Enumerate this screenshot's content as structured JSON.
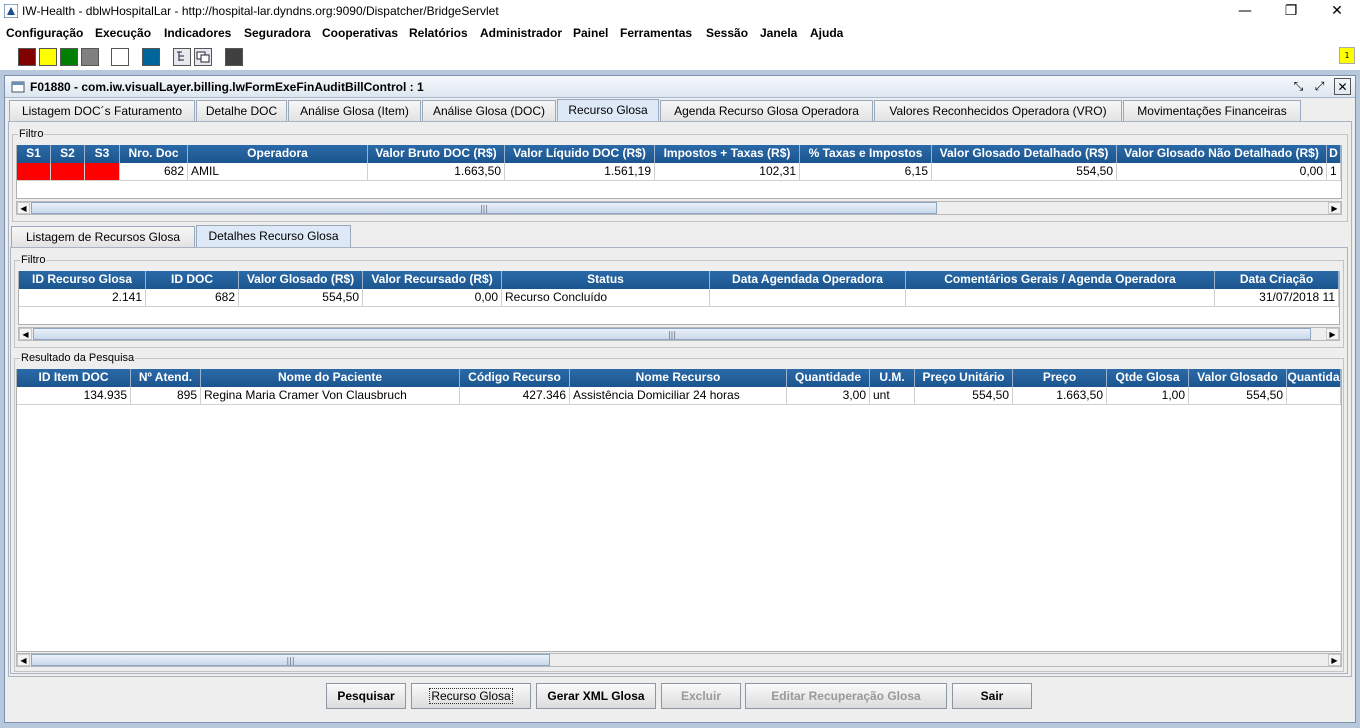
{
  "window": {
    "title": "IW-Health - dblwHospitalLar - http://hospital-lar.dyndns.org:9090/Dispatcher/BridgeServlet",
    "minimize": "—",
    "maximize": "❐",
    "close": "✕"
  },
  "menu": [
    "Configuração",
    "Execução",
    "Indicadores",
    "Seguradora",
    "Cooperativas",
    "Relatórios",
    "Administrador",
    "Painel",
    "Ferramentas",
    "Sessão",
    "Janela",
    "Ajuda"
  ],
  "toolbar": {
    "swatch_colors": [
      "#800000",
      "#ffff00",
      "#008000",
      "#808080",
      "#ffffff",
      "#006699",
      "#404040"
    ],
    "notification": "1"
  },
  "frame": {
    "title": "F01880 - com.iw.visualLayer.billing.lwFormExeFinAuditBillControl : 1"
  },
  "main_tabs": [
    "Listagem DOC´s Faturamento",
    "Detalhe DOC",
    "Análise Glosa (Item)",
    "Análise Glosa (DOC)",
    "Recurso Glosa",
    "Agenda Recurso Glosa Operadora",
    "Valores Reconhecidos Operadora (VRO)",
    "Movimentações Financeiras"
  ],
  "main_tab_active": "Recurso Glosa",
  "filtro1": {
    "label": "Filtro",
    "headers": [
      "S1",
      "S2",
      "S3",
      "Nro. Doc",
      "Operadora",
      "Valor Bruto DOC (R$)",
      "Valor Líquido DOC (R$)",
      "Impostos + Taxas (R$)",
      "% Taxas e Impostos",
      "Valor Glosado Detalhado (R$)",
      "Valor Glosado Não Detalhado (R$)",
      "D"
    ],
    "row": [
      "",
      "",
      "",
      "682",
      "AMIL",
      "1.663,50",
      "1.561,19",
      "102,31",
      "6,15",
      "554,50",
      "0,00",
      "1"
    ]
  },
  "sub_tabs": [
    "Listagem de Recursos Glosa",
    "Detalhes Recurso Glosa"
  ],
  "sub_tab_active": "Detalhes Recurso Glosa",
  "filtro2": {
    "label": "Filtro",
    "headers": [
      "ID Recurso Glosa",
      "ID DOC",
      "Valor Glosado (R$)",
      "Valor Recursado (R$)",
      "Status",
      "Data Agendada Operadora",
      "Comentários Gerais / Agenda Operadora",
      "Data Criação"
    ],
    "row": [
      "2.141",
      "682",
      "554,50",
      "0,00",
      "Recurso Concluído",
      "",
      "",
      "31/07/2018 11"
    ]
  },
  "resultado": {
    "label": "Resultado da Pesquisa",
    "headers": [
      "ID Item DOC",
      "Nº Atend.",
      "Nome do Paciente",
      "Código Recurso",
      "Nome Recurso",
      "Quantidade",
      "U.M.",
      "Preço Unitário",
      "Preço",
      "Qtde Glosa",
      "Valor Glosado",
      "Quantida"
    ],
    "row": [
      "134.935",
      "895",
      "Regina Maria Cramer Von Clausbruch",
      "427.346",
      "Assistência Domiciliar 24 horas",
      "3,00",
      "unt",
      "554,50",
      "1.663,50",
      "1,00",
      "554,50",
      ""
    ]
  },
  "buttons": {
    "pesquisar": "Pesquisar",
    "recurso_glosa": "Recurso Glosa",
    "gerar_xml": "Gerar XML Glosa",
    "excluir": "Excluir",
    "editar_recuperacao": "Editar Recuperação Glosa",
    "sair": "Sair"
  }
}
